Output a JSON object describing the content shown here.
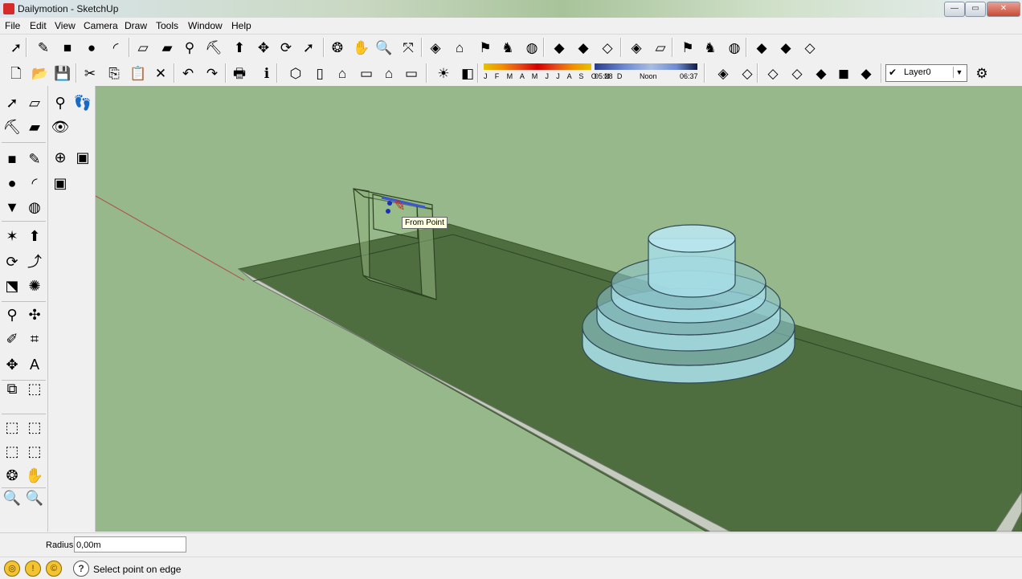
{
  "window": {
    "title": "Dailymotion - SketchUp",
    "min_label": "—",
    "max_label": "▭",
    "close_label": "✕"
  },
  "menu": [
    "File",
    "Edit",
    "View",
    "Camera",
    "Draw",
    "Tools",
    "Window",
    "Help"
  ],
  "toolbar1": {
    "icons": [
      "select-icon",
      "pencil-icon",
      "rectangle-icon",
      "circle-icon",
      "arc-icon",
      "make-component-icon",
      "eraser-icon",
      "tape-measure-icon",
      "paint-bucket-icon",
      "push-pull-icon",
      "move-icon",
      "rotate-icon",
      "follow-me-icon",
      "orbit-icon",
      "pan-icon",
      "zoom-icon",
      "zoom-extents-icon",
      "walkthrough-icon",
      "camera-icon",
      "style-icon",
      "model-icon",
      "globe-icon",
      "sandbox-icon",
      "sandbox-2-icon",
      "sandbox-3-icon",
      "view-1-icon",
      "view-2-icon",
      "style-2-icon",
      "model-2-icon",
      "globe-2-icon",
      "component-icon",
      "component-2-icon",
      "component-3-icon"
    ],
    "glyphs": [
      "➚",
      "✎",
      "■",
      "●",
      "◜",
      "▱",
      "▰",
      "⚲",
      "⛏",
      "⬆",
      "✥",
      "⟳",
      "➚",
      "❂",
      "✋",
      "🔍",
      "⤧",
      "◈",
      "⌂",
      "⚑",
      "♞",
      "◍",
      "◆",
      "◆",
      "◇",
      "◈",
      "▱",
      "⚑",
      "♞",
      "◍",
      "◆",
      "◆",
      "◇"
    ]
  },
  "toolbar2": {
    "icons": [
      "new-icon",
      "open-icon",
      "save-icon",
      "cut-icon",
      "copy-icon",
      "paste-icon",
      "delete-icon",
      "undo-icon",
      "redo-icon",
      "print-icon",
      "info-icon",
      "iso-view-icon",
      "top-view-icon",
      "front-view-icon",
      "right-view-icon",
      "back-view-icon",
      "left-view-icon",
      "shadow-settings-icon",
      "shadows-toggle-icon"
    ],
    "glyphs": [
      "🗋",
      "📂",
      "💾",
      "✂",
      "⎘",
      "📋",
      "✕",
      "↶",
      "↷",
      "🖶",
      "ℹ",
      "⬡",
      "▯",
      "⌂",
      "▭",
      "⌂",
      "▭",
      "☀",
      "◧"
    ],
    "shadow_months": "J F M A M J J A S O N D",
    "shadow_time_start": "05:28",
    "shadow_time_mid": "Noon",
    "shadow_time_end": "06:37",
    "style_icons": [
      "xray-icon",
      "wireframe-icon",
      "hidden-line-icon",
      "shaded-icon",
      "shaded-texture-icon",
      "monochrome-icon",
      "hidden-geometry-icon"
    ],
    "style_glyphs": [
      "◈",
      "◇",
      "◇",
      "◇",
      "◆",
      "◼",
      "◆"
    ],
    "layer_check": "✔",
    "layer_name": "Layer0",
    "layer_arrow": "▼",
    "layer_manager_glyph": "⚙"
  },
  "palette": {
    "left_glyphs": [
      "➚",
      "▱",
      "⛏",
      "▰",
      "■",
      "✎",
      "●",
      "◜",
      "▼",
      "◍",
      "✶",
      "⬆",
      "⟳",
      "⤴",
      "⬔",
      "✺",
      "⚲",
      "✣",
      "✐",
      "⌗",
      "✥",
      "A",
      "⧉",
      "⬚",
      "⬚",
      "⬚",
      "⬚",
      "⬚",
      "❂",
      "✋",
      "🔍",
      "🔍"
    ],
    "left_icons": [
      "select-icon",
      "make-component-icon",
      "paint-bucket-icon",
      "eraser-icon",
      "rectangle-icon",
      "line-icon",
      "circle-icon",
      "arc-icon",
      "polygon-icon",
      "freehand-icon",
      "move-icon",
      "push-pull-icon",
      "rotate-icon",
      "follow-me-icon",
      "scale-icon",
      "offset-icon",
      "tape-measure-icon",
      "dimension-icon",
      "protractor-icon",
      "text-icon",
      "axes-icon",
      "3d-text-icon",
      "outer-shell-icon",
      "intersect-icon",
      "union-icon",
      "subtract-icon",
      "trim-icon",
      "split-icon",
      "orbit-icon",
      "pan-icon",
      "zoom-icon",
      "zoom-window-icon"
    ],
    "right_glyphs": [
      "⚲",
      "👣",
      "👁",
      "⊕",
      "▣",
      "▣"
    ],
    "right_icons": [
      "position-camera-icon",
      "walk-icon",
      "look-around-icon",
      "section-plane-icon",
      "display-section-icon",
      "section-fill-icon"
    ]
  },
  "viewport": {
    "tooltip": "From Point",
    "cursor_glyph": "✎"
  },
  "measurements": {
    "label": "Radius",
    "value": "0,00m"
  },
  "statusbar": {
    "geo_glyphs": [
      "◎",
      "!",
      "©"
    ],
    "help_glyph": "?",
    "text": "Select point on edge"
  },
  "colors": {
    "viewport_bg": "#96b88a",
    "ground": "#4f6e40",
    "glass": "#a7dde6",
    "frame": "#8fb07d"
  }
}
